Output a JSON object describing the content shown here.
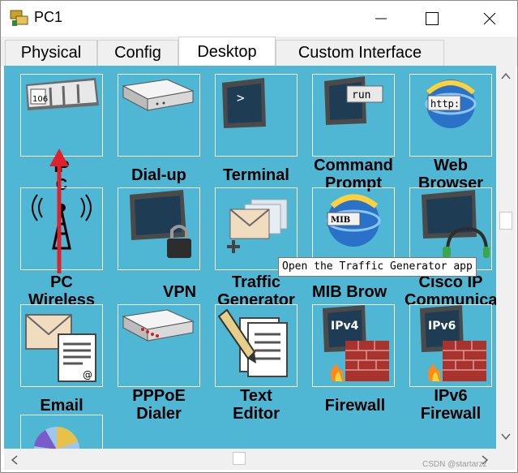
{
  "window": {
    "title": "PC1"
  },
  "tabs": [
    {
      "label": "Physical"
    },
    {
      "label": "Config"
    },
    {
      "label": "Desktop"
    },
    {
      "label": "Custom Interface"
    }
  ],
  "icons": {
    "ip_config": {
      "lines": [
        "IP",
        "C"
      ],
      "badge": "106"
    },
    "dialup": {
      "lines": [
        "Dial-up"
      ]
    },
    "terminal": {
      "lines": [
        "Terminal"
      ],
      "glyph": ">"
    },
    "command_prompt": {
      "lines": [
        "Command",
        "Prompt"
      ],
      "badge": "run"
    },
    "web_browser": {
      "lines": [
        "Web",
        "Browser"
      ],
      "badge": "http:"
    },
    "pc_wireless": {
      "lines": [
        "PC",
        "Wireless"
      ]
    },
    "vpn": {
      "lines": [
        "VPN"
      ]
    },
    "traffic_generator": {
      "lines": [
        "Traffic",
        "Generator"
      ]
    },
    "mib_browser": {
      "lines": [
        "MIB Brow"
      ],
      "badge": "MIB"
    },
    "cisco_ip_comm": {
      "lines": [
        "Cisco IP",
        "Communicator"
      ]
    },
    "email": {
      "lines": [
        "Email"
      ],
      "badge": "@"
    },
    "pppoe_dialer": {
      "lines": [
        "PPPoE",
        "Dialer"
      ]
    },
    "text_editor": {
      "lines": [
        "Text",
        "Editor"
      ]
    },
    "firewall": {
      "lines": [
        "Firewall"
      ],
      "badge": "IPv4"
    },
    "ipv6_firewall": {
      "lines": [
        "IPv6",
        "Firewall"
      ],
      "badge": "IPv6"
    }
  },
  "tooltip": "Open the Traffic Generator app",
  "watermark": "CSDN @startarzz",
  "colors": {
    "background": "#4fb7d4",
    "arrow": "#e0202a"
  }
}
